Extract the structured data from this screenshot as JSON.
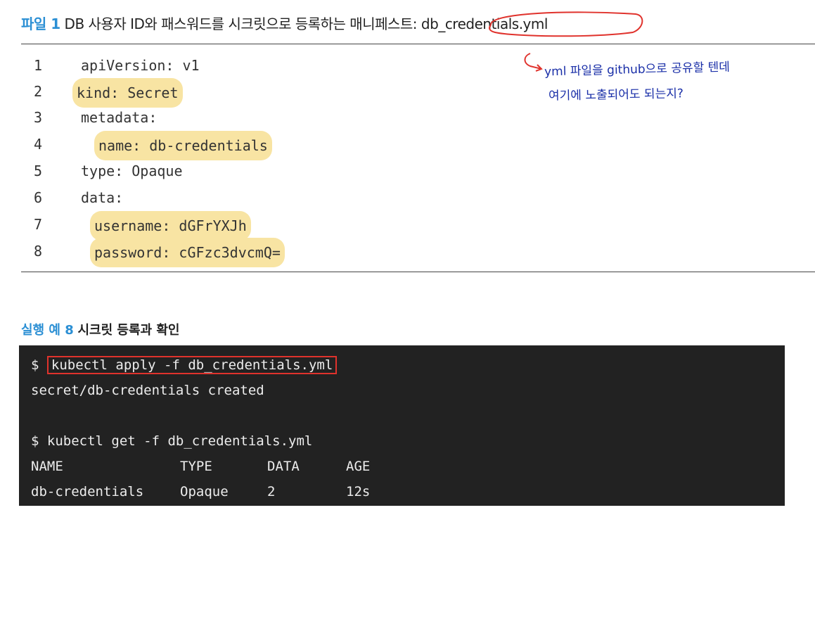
{
  "listing": {
    "label": "파일 1",
    "title": "DB 사용자 ID와 패스워드를 시크릿으로 등록하는 매니페스트:",
    "filename": "db_credentials.yml",
    "lines": [
      {
        "num": "1",
        "text": "apiVersion: v1"
      },
      {
        "num": "2",
        "text": "kind: Secret"
      },
      {
        "num": "3",
        "text": "metadata:"
      },
      {
        "num": "4",
        "text": "name: db-credentials"
      },
      {
        "num": "5",
        "text": "type: Opaque"
      },
      {
        "num": "6",
        "text": "data:"
      },
      {
        "num": "7",
        "text": "username: dGFrYXJh"
      },
      {
        "num": "8",
        "text": "password: cGFzc3dvcmQ="
      }
    ],
    "highlight_color": "#f8e4a3"
  },
  "note": {
    "line1": "yml 파일을 github으로 공유할 텐데",
    "line2": "여기에 노출되어도 되는지?",
    "color": "#1a2fa8"
  },
  "example": {
    "label": "실행 예 8",
    "title": "시크릿 등록과 확인",
    "terminal": {
      "prompt": "$",
      "cmd1": "kubectl apply -f db_credentials.yml",
      "out1": "secret/db-credentials created",
      "cmd2": "$ kubectl get -f db_credentials.yml",
      "table": {
        "headers": [
          "NAME",
          "TYPE",
          "DATA",
          "AGE"
        ],
        "row": [
          "db-credentials",
          "Opaque",
          "2",
          "12s"
        ]
      }
    }
  },
  "colors": {
    "accent": "#2b8fd4",
    "terminal_bg": "#222222",
    "annotation_red": "#e0322c"
  }
}
